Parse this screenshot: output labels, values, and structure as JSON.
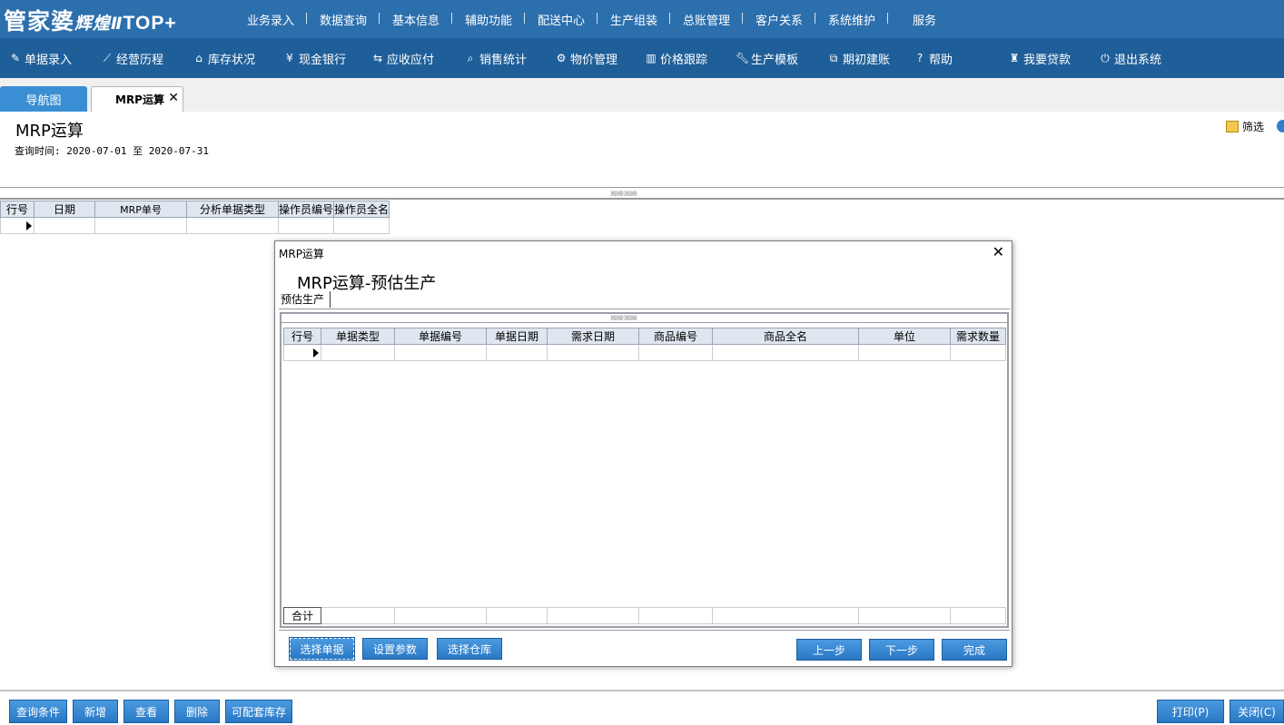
{
  "app": {
    "logo_main": "管家婆",
    "logo_sub": "辉煌Ⅱ",
    "logo_top": "TOP+",
    "top_menu": [
      "业务录入",
      "数据查询",
      "基本信息",
      "辅助功能",
      "配送中心",
      "生产组装",
      "总账管理",
      "客户关系",
      "系统维护",
      "服务"
    ]
  },
  "navbar": [
    {
      "label": "单据录入",
      "icon": "edit-icon"
    },
    {
      "label": "经营历程",
      "icon": "chart-line-icon"
    },
    {
      "label": "库存状况",
      "icon": "home-icon"
    },
    {
      "label": "现金银行",
      "icon": "yen-icon"
    },
    {
      "label": "应收应付",
      "icon": "exchange-icon"
    },
    {
      "label": "销售统计",
      "icon": "search-icon"
    },
    {
      "label": "物价管理",
      "icon": "gear-icon"
    },
    {
      "label": "价格跟踪",
      "icon": "bar-chart-icon"
    },
    {
      "label": "生产模板",
      "icon": "wrench-icon"
    },
    {
      "label": "期初建账",
      "icon": "external-link-icon"
    },
    {
      "label": "帮助",
      "icon": "question-icon"
    },
    {
      "label": "我要贷款",
      "icon": "money-bag-icon"
    },
    {
      "label": "退出系统",
      "icon": "power-icon"
    }
  ],
  "tabs": {
    "nav_label": "导航图",
    "active_label": "MRP运算",
    "close": "✕"
  },
  "page": {
    "title": "MRP运算",
    "query_time": "查询时间: 2020-07-01 至 2020-07-31",
    "filter_label": "筛选"
  },
  "main_grid": {
    "columns": [
      "行号",
      "日期",
      "MRP单号",
      "分析单据类型",
      "操作员编号",
      "操作员全名"
    ]
  },
  "dialog": {
    "caption": "MRP运算",
    "close": "✕",
    "heading": "MRP运算-预估生产",
    "tab": "预估生产",
    "columns": [
      "行号",
      "单据类型",
      "单据编号",
      "单据日期",
      "需求日期",
      "商品编号",
      "商品全名",
      "单位",
      "需求数量"
    ],
    "total_label": "合计",
    "buttons": {
      "select_doc": "选择单据",
      "set_params": "设置参数",
      "select_warehouse": "选择仓库",
      "prev": "上一步",
      "next": "下一步",
      "finish": "完成"
    }
  },
  "bottom": {
    "query_cond": "查询条件",
    "add": "新增",
    "view": "查看",
    "delete": "删除",
    "configurable_stock": "可配套库存",
    "print": "打印(P)",
    "close": "关闭(C)"
  }
}
